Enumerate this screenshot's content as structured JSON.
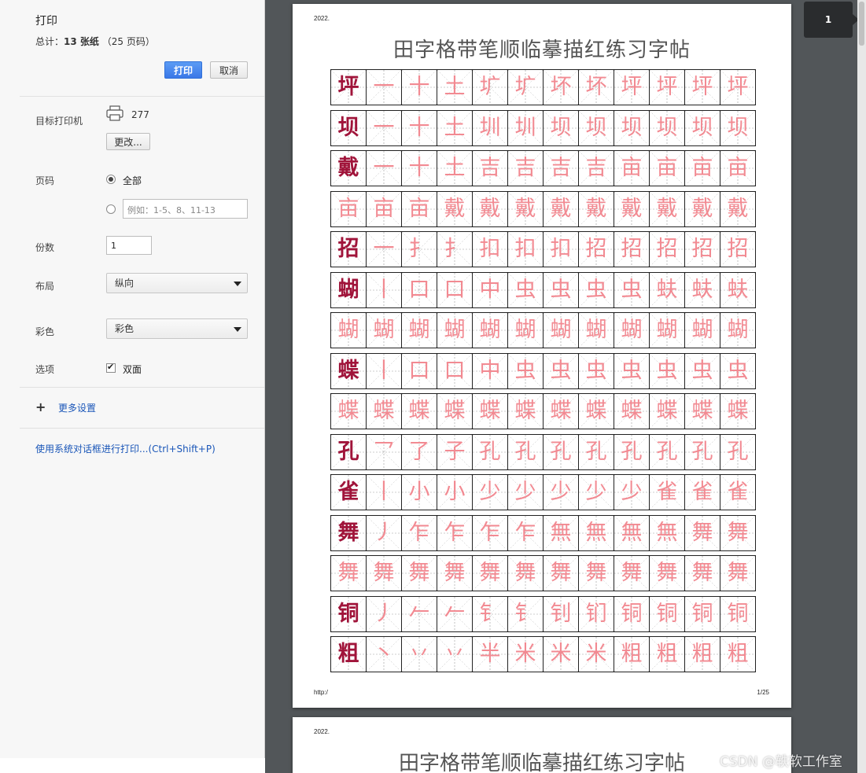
{
  "sidebar": {
    "title": "打印",
    "summary_prefix": "总计：",
    "summary_sheets": "13 张纸",
    "summary_pages": "（25 页码）",
    "print_button": "打印",
    "cancel_button": "取消",
    "destination_label": "目标打印机",
    "printer_name": "277",
    "change_button": "更改...",
    "pages_label": "页码",
    "pages_all": "全部",
    "pages_custom_placeholder": "例如：1-5、8、11-13",
    "copies_label": "份数",
    "copies_value": "1",
    "layout_label": "布局",
    "layout_value": "纵向",
    "color_label": "彩色",
    "color_value": "彩色",
    "options_label": "选项",
    "duplex_label": "双面",
    "duplex_checked": true,
    "more_settings": "更多设置",
    "system_dialog_link": "使用系统对话框进行打印...(Ctrl+Shift+P)"
  },
  "preview": {
    "page_badge": "1",
    "page1": {
      "header": "2022.",
      "title": "田字格带笔顺临摹描红练习字帖",
      "footer_left": "http:/",
      "page_number": "1/25"
    },
    "page2": {
      "header": "2022.",
      "title": "田字格带笔顺临摹描红练习字帖"
    },
    "rows": [
      {
        "model": "坪",
        "cells": [
          "一",
          "十",
          "土",
          "圹",
          "圹",
          "坏",
          "坏",
          "坪",
          "坪",
          "坪",
          "坪"
        ]
      },
      {
        "model": "坝",
        "cells": [
          "一",
          "十",
          "土",
          "圳",
          "圳",
          "坝",
          "坝",
          "坝",
          "坝",
          "坝",
          "坝"
        ]
      },
      {
        "model": "戴",
        "cells": [
          "一",
          "十",
          "土",
          "吉",
          "吉",
          "吉",
          "吉",
          "亩",
          "亩",
          "亩",
          "亩"
        ]
      },
      {
        "model": "",
        "cells": [
          "亩",
          "亩",
          "亩",
          "戴",
          "戴",
          "戴",
          "戴",
          "戴",
          "戴",
          "戴",
          "戴",
          "戴"
        ]
      },
      {
        "model": "招",
        "cells": [
          "一",
          "扌",
          "扌",
          "扣",
          "扣",
          "扣",
          "招",
          "招",
          "招",
          "招",
          "招"
        ]
      },
      {
        "model": "蝴",
        "cells": [
          "丨",
          "口",
          "口",
          "中",
          "虫",
          "虫",
          "虫",
          "虫",
          "蚨",
          "蚨",
          "蚨"
        ]
      },
      {
        "model": "",
        "cells": [
          "蝴",
          "蝴",
          "蝴",
          "蝴",
          "蝴",
          "蝴",
          "蝴",
          "蝴",
          "蝴",
          "蝴",
          "蝴",
          "蝴"
        ]
      },
      {
        "model": "蝶",
        "cells": [
          "丨",
          "口",
          "口",
          "中",
          "虫",
          "虫",
          "虫",
          "虫",
          "虫",
          "虫",
          "虫"
        ]
      },
      {
        "model": "",
        "cells": [
          "蝶",
          "蝶",
          "蝶",
          "蝶",
          "蝶",
          "蝶",
          "蝶",
          "蝶",
          "蝶",
          "蝶",
          "蝶",
          "蝶"
        ]
      },
      {
        "model": "孔",
        "cells": [
          "乛",
          "了",
          "子",
          "孔",
          "孔",
          "孔",
          "孔",
          "孔",
          "孔",
          "孔",
          "孔"
        ]
      },
      {
        "model": "雀",
        "cells": [
          "丨",
          "小",
          "小",
          "少",
          "少",
          "少",
          "少",
          "少",
          "雀",
          "雀",
          "雀"
        ]
      },
      {
        "model": "舞",
        "cells": [
          "丿",
          "乍",
          "乍",
          "乍",
          "乍",
          "無",
          "無",
          "無",
          "無",
          "舞",
          "舞"
        ]
      },
      {
        "model": "",
        "cells": [
          "舞",
          "舞",
          "舞",
          "舞",
          "舞",
          "舞",
          "舞",
          "舞",
          "舞",
          "舞",
          "舞",
          "舞"
        ]
      },
      {
        "model": "铜",
        "cells": [
          "丿",
          "𠂉",
          "𠂉",
          "钅",
          "钅",
          "钊",
          "钔",
          "铜",
          "铜",
          "铜",
          "铜"
        ]
      },
      {
        "model": "粗",
        "cells": [
          "丶",
          "丷",
          "丷",
          "半",
          "米",
          "米",
          "米",
          "粗",
          "粗",
          "粗",
          "粗"
        ]
      }
    ]
  },
  "watermark": "CSDN @轶软工作室",
  "colors": {
    "model_char": "#a0143a",
    "trace_char": "#f28a92",
    "primary_button": "#3b78e7",
    "preview_bg": "#525659",
    "link": "#1a56b8"
  }
}
